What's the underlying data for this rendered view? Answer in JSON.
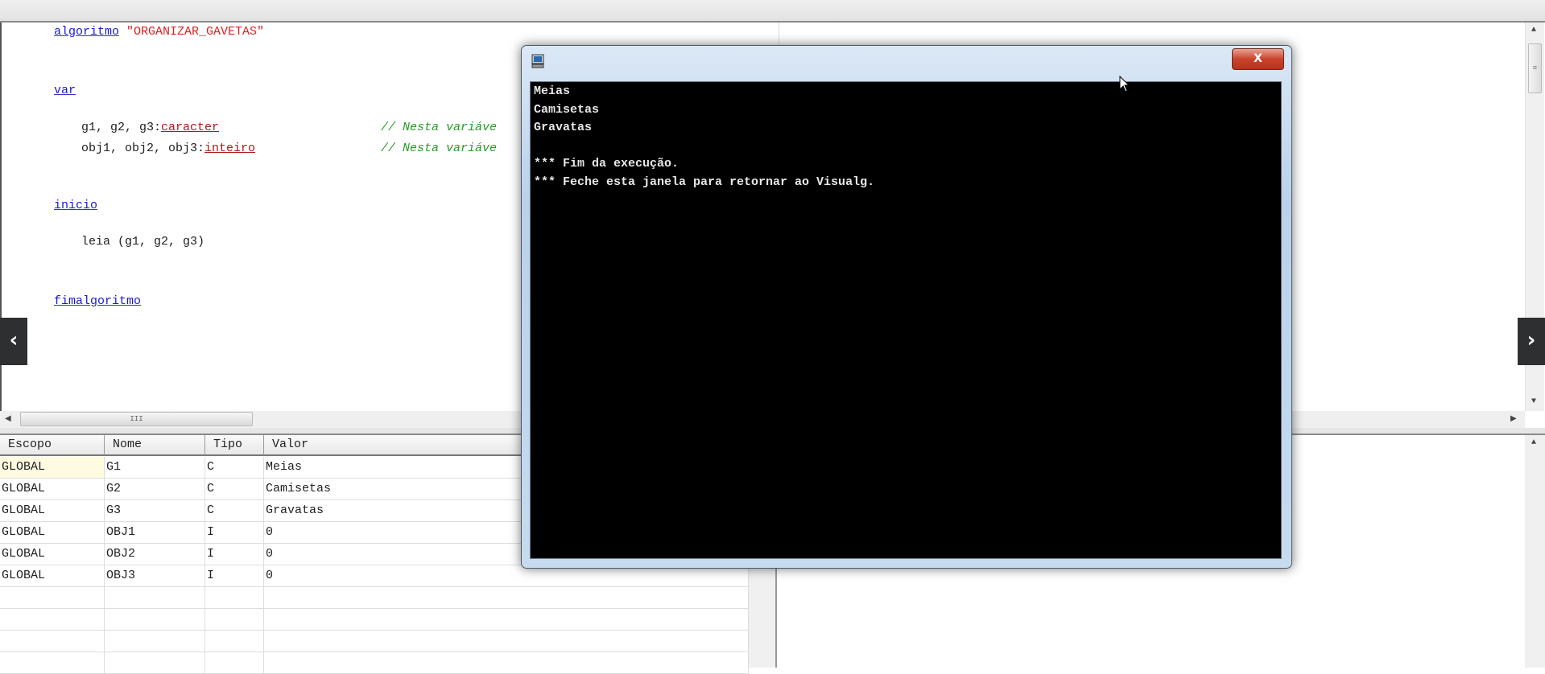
{
  "editor": {
    "lines": {
      "l1_kw": "algoritmo",
      "l1_str": "\"ORGANIZAR_GAVETAS\"",
      "l2_kw": "var",
      "l3_vars": "g1, g2, g3:",
      "l3_type": "caracter",
      "l3_comment": "// Nesta variáve",
      "l4_vars": "obj1, obj2, obj3:",
      "l4_type": "inteiro",
      "l4_comment": "// Nesta variáve",
      "l5_kw": "inicio",
      "l6_code": "leia (g1, g2, g3)",
      "l7_kw": "fimalgoritmo"
    },
    "hscroll_grip": "III",
    "vscroll_grip": "≡"
  },
  "variables": {
    "headers": [
      "Escopo",
      "Nome",
      "Tipo",
      "Valor"
    ],
    "rows": [
      [
        "GLOBAL",
        "G1",
        "C",
        "Meias"
      ],
      [
        "GLOBAL",
        "G2",
        "C",
        "Camisetas"
      ],
      [
        "GLOBAL",
        "G3",
        "C",
        "Gravatas"
      ],
      [
        "GLOBAL",
        "OBJ1",
        "I",
        "0"
      ],
      [
        "GLOBAL",
        "OBJ2",
        "I",
        "0"
      ],
      [
        "GLOBAL",
        "OBJ3",
        "I",
        "0"
      ]
    ]
  },
  "console": {
    "close_label": "X",
    "output": [
      "Meias",
      "Camisetas",
      "Gravatas",
      "",
      "*** Fim da execução.",
      "*** Feche esta janela para retornar ao Visualg."
    ]
  },
  "nav": {
    "prev": "‹",
    "next": "›"
  }
}
